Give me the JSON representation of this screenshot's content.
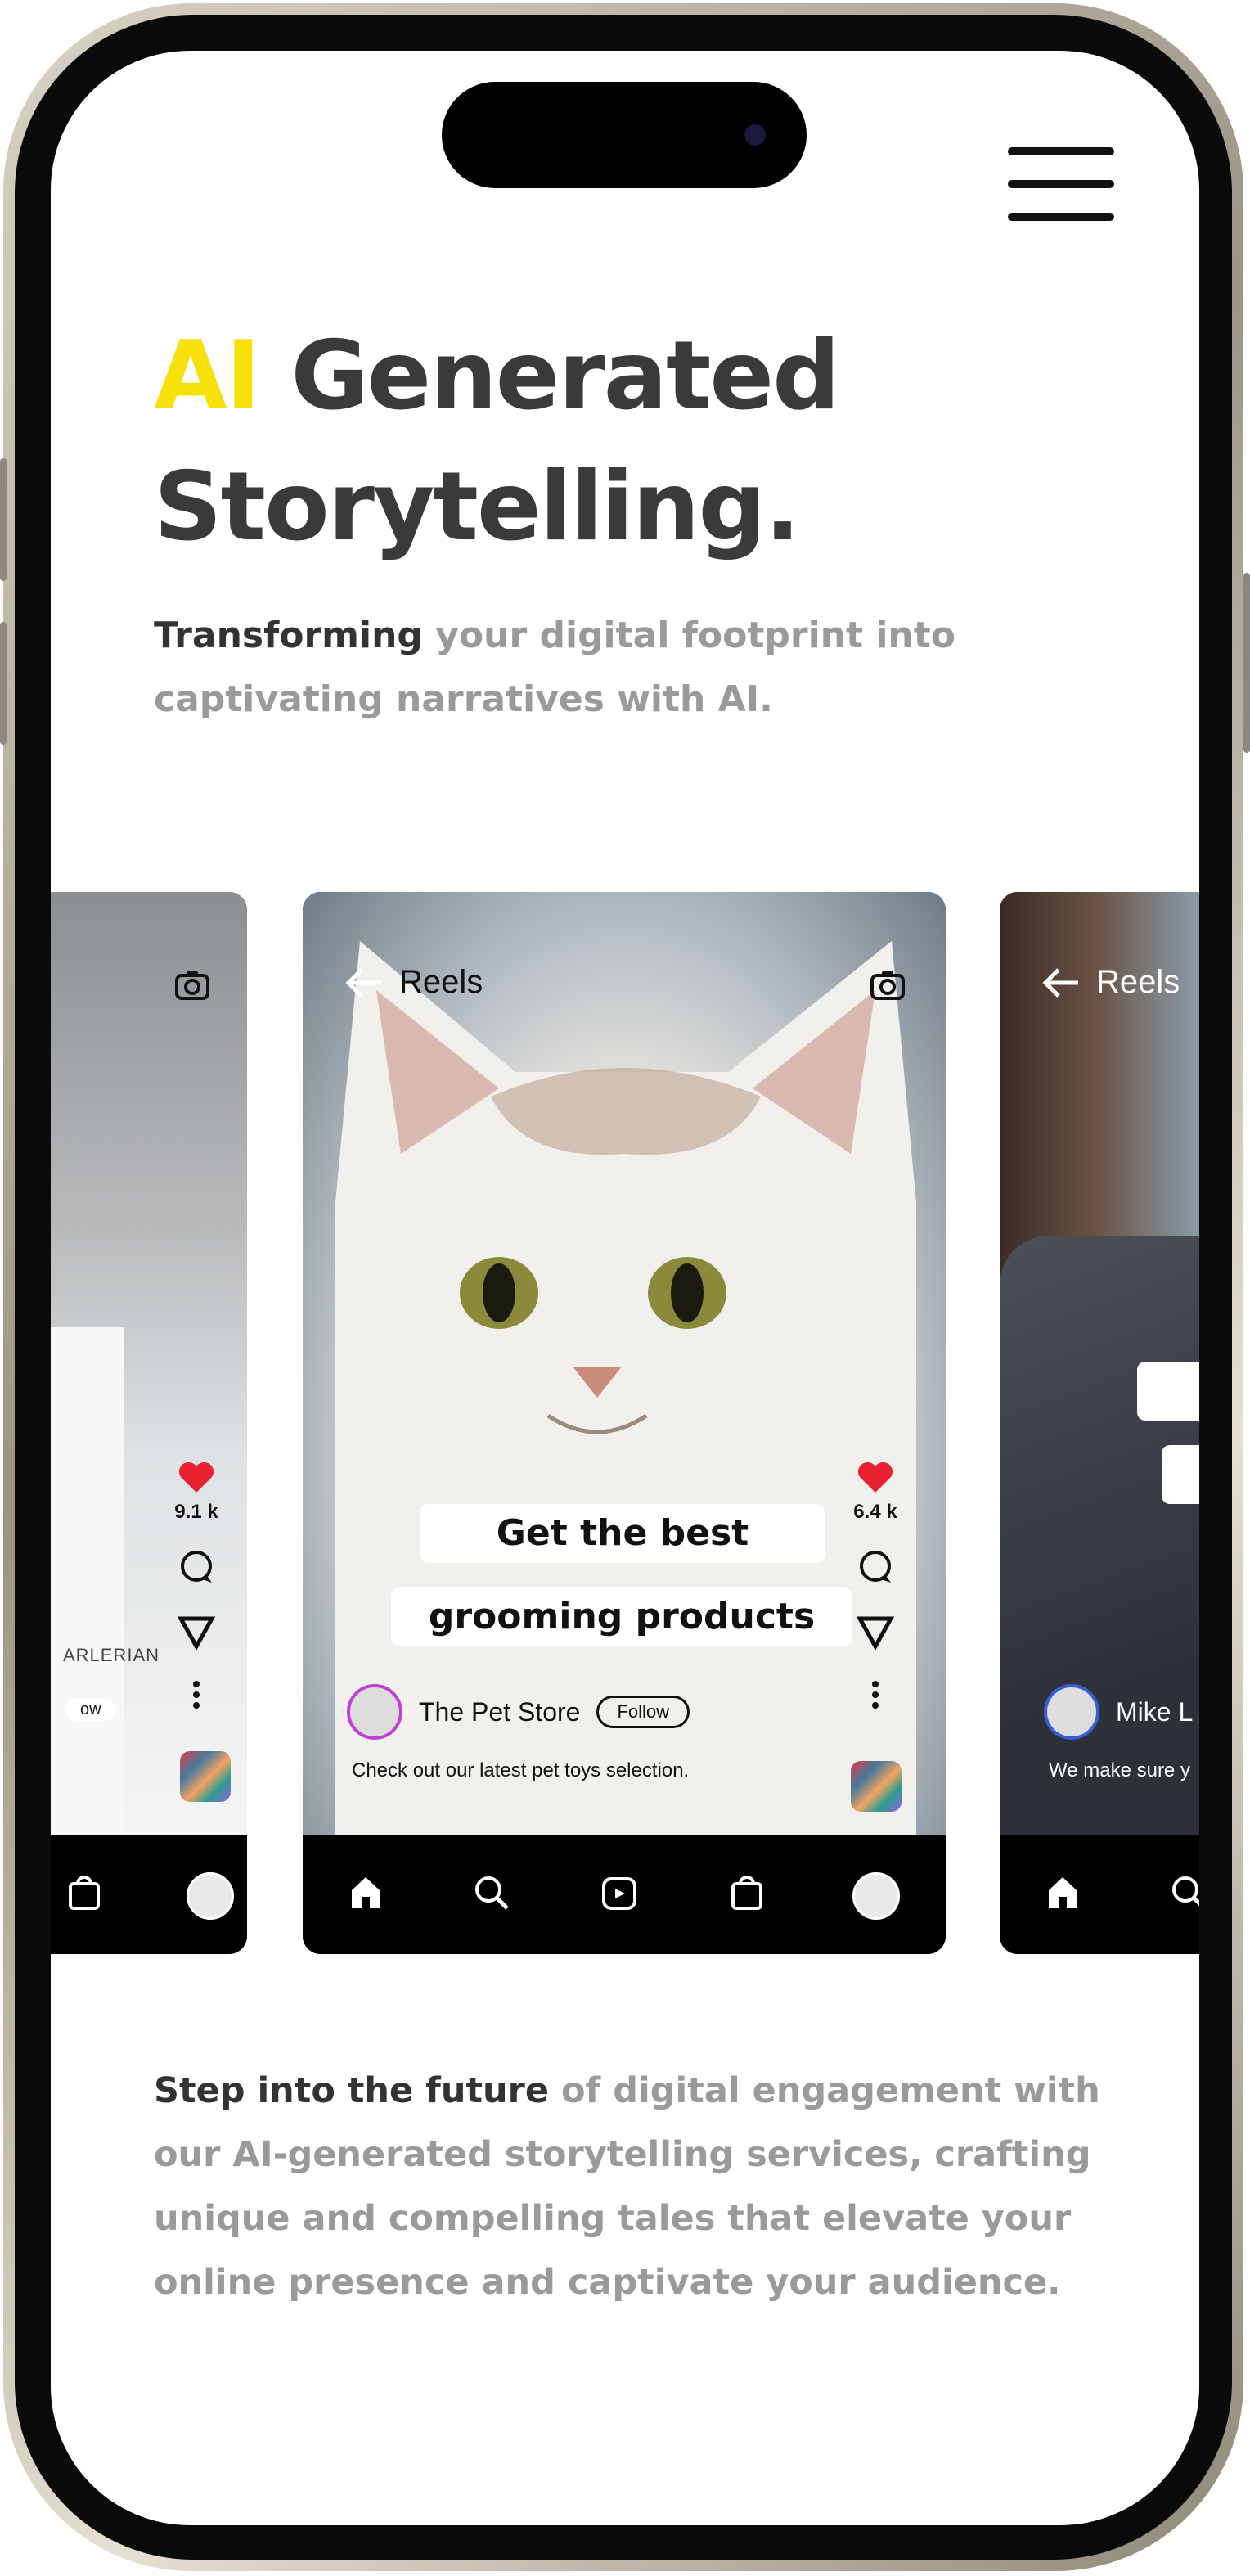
{
  "hero": {
    "title_accent": "AI",
    "title_rest": "Generated",
    "title_line2": "Storytelling.",
    "subtitle_strong": "Transforming",
    "subtitle_rest": "your digital footprint into captivating narratives with AI."
  },
  "cards": {
    "left": {
      "likes": "9.1 k",
      "follow_label": "ow",
      "badge_text": "ARLERIAN"
    },
    "center": {
      "back_label": "Reels",
      "likes": "6.4 k",
      "caption_line1": "Get the best",
      "caption_line2": "grooming products",
      "author": "The Pet Store",
      "follow_label": "Follow",
      "post_caption": "Check out our latest pet toys selection."
    },
    "right": {
      "back_label": "Reels",
      "author": "Mike L",
      "post_caption": "We make sure y"
    }
  },
  "body": {
    "strong": "Step into the future",
    "rest": "of digital engagement with our AI-generated storytelling services, crafting unique and compelling tales that elevate your online presence and captivate your audience."
  },
  "colors": {
    "accent": "#f7e10a",
    "heading": "#3a3a3a",
    "muted": "#9a9a9a",
    "like_red": "#e8212f"
  },
  "icons": [
    "menu-icon",
    "back-arrow-icon",
    "camera-icon",
    "heart-icon",
    "comment-icon",
    "share-icon",
    "more-icon",
    "home-icon",
    "search-icon",
    "reels-icon",
    "shop-icon",
    "profile-icon"
  ]
}
